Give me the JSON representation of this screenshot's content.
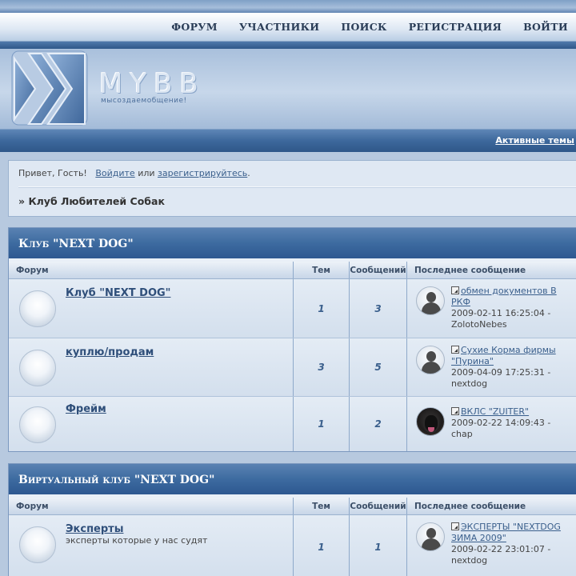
{
  "nav": {
    "items": [
      "ФОРУМ",
      "УЧАСТНИКИ",
      "ПОИСК",
      "РЕГИСТРАЦИЯ",
      "ВОЙТИ"
    ]
  },
  "logo": {
    "text": "MYBB",
    "slogan": "мысоздаемобщение!"
  },
  "subnav": {
    "active_topics": "Активные темы"
  },
  "welcome": {
    "greeting": "Привет, Гость!",
    "login_link": "Войдите",
    "or_text": "или",
    "register_link": "зарегистрируйтесь",
    "period": ".",
    "breadcrumb_prefix": "»",
    "breadcrumb": "Клуб Любителей Собак"
  },
  "columns": {
    "forum": "Форум",
    "topics": "Тем",
    "posts": "Сообщений",
    "last_post": "Последнее сообщение"
  },
  "categories": [
    {
      "title": "Клуб \"NEXT DOG\"",
      "forums": [
        {
          "name": "Клуб \"NEXT DOG\"",
          "description": "",
          "topics": "1",
          "posts": "3",
          "last_title": "обмен документов В РКФ",
          "last_date": "2009-02-11 16:25:04 -",
          "last_user": "ZolotoNebes",
          "avatar": "user-placeholder"
        },
        {
          "name": "куплю/продам",
          "description": "",
          "topics": "3",
          "posts": "5",
          "last_title": "Сухие Корма фирмы \"Пурина\"",
          "last_date": "2009-04-09 17:25:31 -",
          "last_user": "nextdog",
          "avatar": "user-placeholder"
        },
        {
          "name": "Фрейм",
          "description": "",
          "topics": "1",
          "posts": "2",
          "last_title": "ВКЛС \"ZUITER\"",
          "last_date": "2009-02-22 14:09:43 -",
          "last_user": "chap",
          "avatar": "dog-photo"
        }
      ]
    },
    {
      "title": "Виртуальный клуб \"NEXT DOG\"",
      "forums": [
        {
          "name": "Эксперты",
          "description": "эксперты которые у нас судят",
          "topics": "1",
          "posts": "1",
          "last_title": "ЭКСПЕРТЫ \"NEXTDOG ЗИМА 2009\"",
          "last_date": "2009-02-22 23:01:07 -",
          "last_user": "nextdog",
          "avatar": "user-placeholder"
        }
      ]
    }
  ],
  "colors": {
    "header_blue": "#3d6ba0",
    "link": "#3a5f8c",
    "page_bg": "#b7c9df"
  }
}
